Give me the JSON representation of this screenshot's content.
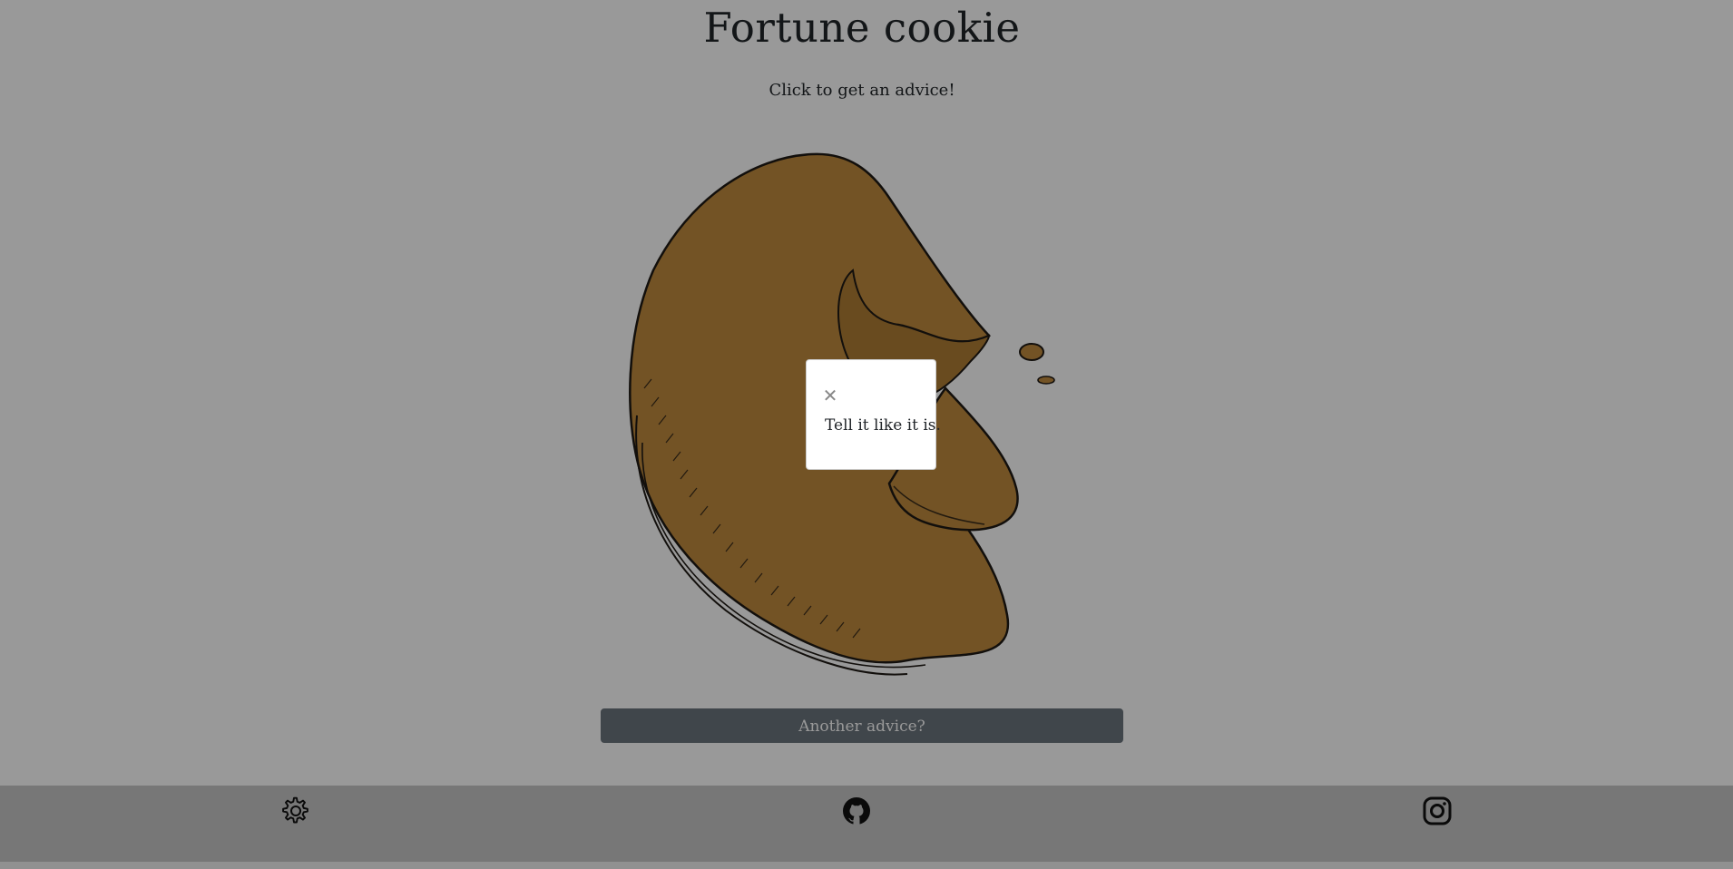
{
  "header": {
    "title": "Fortune cookie",
    "subtitle": "Click to get an advice!"
  },
  "main": {
    "another_button_label": "Another advice?"
  },
  "footer": {
    "icons": [
      "gear-icon",
      "github-icon",
      "instagram-icon"
    ]
  },
  "modal": {
    "close_symbol": "✕",
    "advice_text": "Tell it like it is."
  },
  "colors": {
    "cookie": "#c08a3e",
    "button": "#6c757d",
    "footer": "#c6c6c6",
    "overlay": "rgba(0,0,0,0.4)"
  }
}
